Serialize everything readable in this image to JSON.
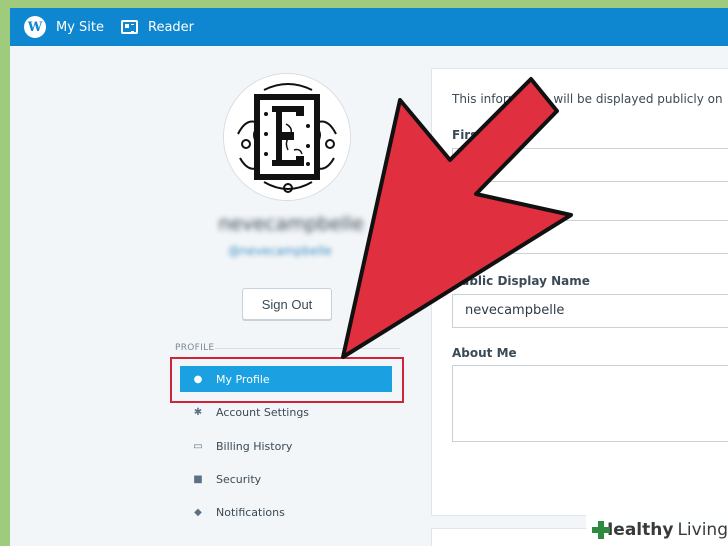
{
  "topbar": {
    "my_site": "My Site",
    "reader": "Reader",
    "logo_letter": "W"
  },
  "profile": {
    "username": "nevecampbelle",
    "handle": "@nevecampbelle",
    "sign_out": "Sign Out"
  },
  "sidebar": {
    "section_label": "PROFILE",
    "items": [
      {
        "label": "My Profile",
        "icon": "person-icon",
        "active": true
      },
      {
        "label": "Account Settings",
        "icon": "gear-icon",
        "active": false
      },
      {
        "label": "Billing History",
        "icon": "card-icon",
        "active": false
      },
      {
        "label": "Security",
        "icon": "lock-icon",
        "active": false
      },
      {
        "label": "Notifications",
        "icon": "bell-icon",
        "active": false
      }
    ]
  },
  "form": {
    "info_text": "This information will be displayed publicly on",
    "first_name_label": "First Name",
    "first_name_value": "",
    "last_name_value": "",
    "display_name_label": "Public Display Name",
    "display_name_value": "nevecampbelle",
    "about_label": "About Me"
  },
  "watermark": {
    "brand_bold": "Healthy",
    "brand_light": "Living"
  },
  "colors": {
    "topbar": "#0f87d0",
    "active_item": "#1ba1e2",
    "arrow": "#e0303f",
    "highlight_border": "#d0243a"
  }
}
